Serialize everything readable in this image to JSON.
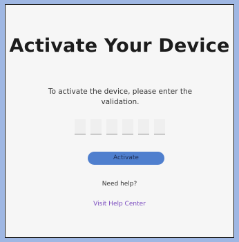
{
  "colors": {
    "page_background": "#9fb7e3",
    "card_background": "#f6f6f6",
    "border": "#1f1f1f",
    "primary_button": "#4f7fce",
    "primary_button_text": "#1f2f56",
    "link": "#7a4bbf",
    "text": "#333333",
    "title": "#1c1c1c"
  },
  "activation": {
    "title": "Activate Your Device",
    "instructions": "To activate the device, please enter the validation.",
    "code_fields": [
      {
        "value": "",
        "placeholder": ""
      },
      {
        "value": "",
        "placeholder": ""
      },
      {
        "value": "",
        "placeholder": ""
      },
      {
        "value": "",
        "placeholder": ""
      },
      {
        "value": "",
        "placeholder": ""
      },
      {
        "value": "",
        "placeholder": ""
      }
    ],
    "activate_button_label": "Activate",
    "help_prompt": "Need help?",
    "help_link_label": "Visit Help Center"
  }
}
